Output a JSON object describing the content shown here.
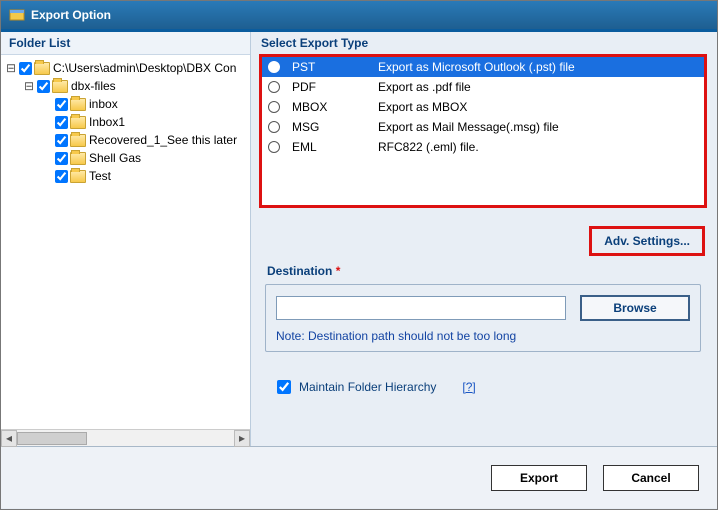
{
  "window": {
    "title": "Export Option"
  },
  "left": {
    "title": "Folder List",
    "tree": {
      "root": {
        "label": "C:\\Users\\admin\\Desktop\\DBX Con"
      },
      "sub": {
        "label": "dbx-files"
      },
      "items": [
        {
          "label": "inbox"
        },
        {
          "label": "Inbox1"
        },
        {
          "label": "Recovered_1_See this later"
        },
        {
          "label": "Shell Gas"
        },
        {
          "label": "Test"
        }
      ]
    }
  },
  "right": {
    "title": "Select Export Type",
    "options": [
      {
        "code": "PST",
        "desc": "Export as Microsoft Outlook (.pst) file",
        "selected": true
      },
      {
        "code": "PDF",
        "desc": "Export as .pdf file",
        "selected": false
      },
      {
        "code": "MBOX",
        "desc": "Export as MBOX",
        "selected": false
      },
      {
        "code": "MSG",
        "desc": "Export as Mail Message(.msg) file",
        "selected": false
      },
      {
        "code": "EML",
        "desc": "RFC822 (.eml) file.",
        "selected": false
      }
    ],
    "adv_label": "Adv. Settings...",
    "destination_label": "Destination",
    "destination_required": "*",
    "destination_value": "",
    "browse_label": "Browse",
    "note": "Note: Destination path should not be too long",
    "maintain_label": "Maintain Folder Hierarchy",
    "maintain_checked": true,
    "help_label": "[?]"
  },
  "footer": {
    "export": "Export",
    "cancel": "Cancel"
  }
}
